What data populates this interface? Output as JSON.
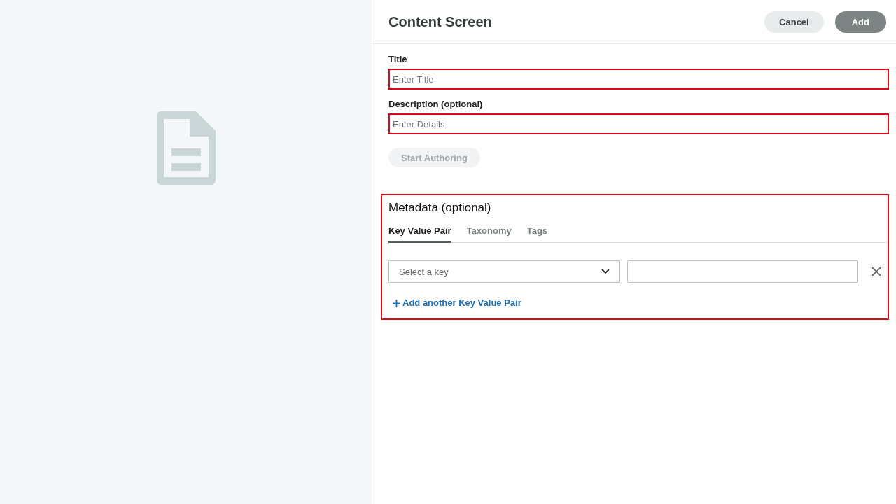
{
  "header": {
    "title": "Content Screen",
    "buttons": [
      {
        "label": "Cancel",
        "kind": "secondary"
      },
      {
        "label": "Add",
        "kind": "primary"
      }
    ]
  },
  "form": {
    "fields": [
      {
        "label": "Title",
        "placeholder": "Enter Title",
        "highlighted": true
      },
      {
        "label": "Description (optional)",
        "placeholder": "Enter Details",
        "highlighted": true
      }
    ],
    "start_authoring": {
      "label": "Start Authoring",
      "disabled": true
    }
  },
  "metadata": {
    "title": "Metadata (optional)",
    "highlighted": true,
    "tabs": [
      {
        "label": "Key Value Pair",
        "selected": true
      },
      {
        "label": "Taxonomy",
        "selected": false
      },
      {
        "label": "Tags",
        "selected": false
      }
    ],
    "pairs": [
      {
        "key_placeholder": "Select a key"
      }
    ],
    "add_link": "Add another Key Value Pair"
  }
}
